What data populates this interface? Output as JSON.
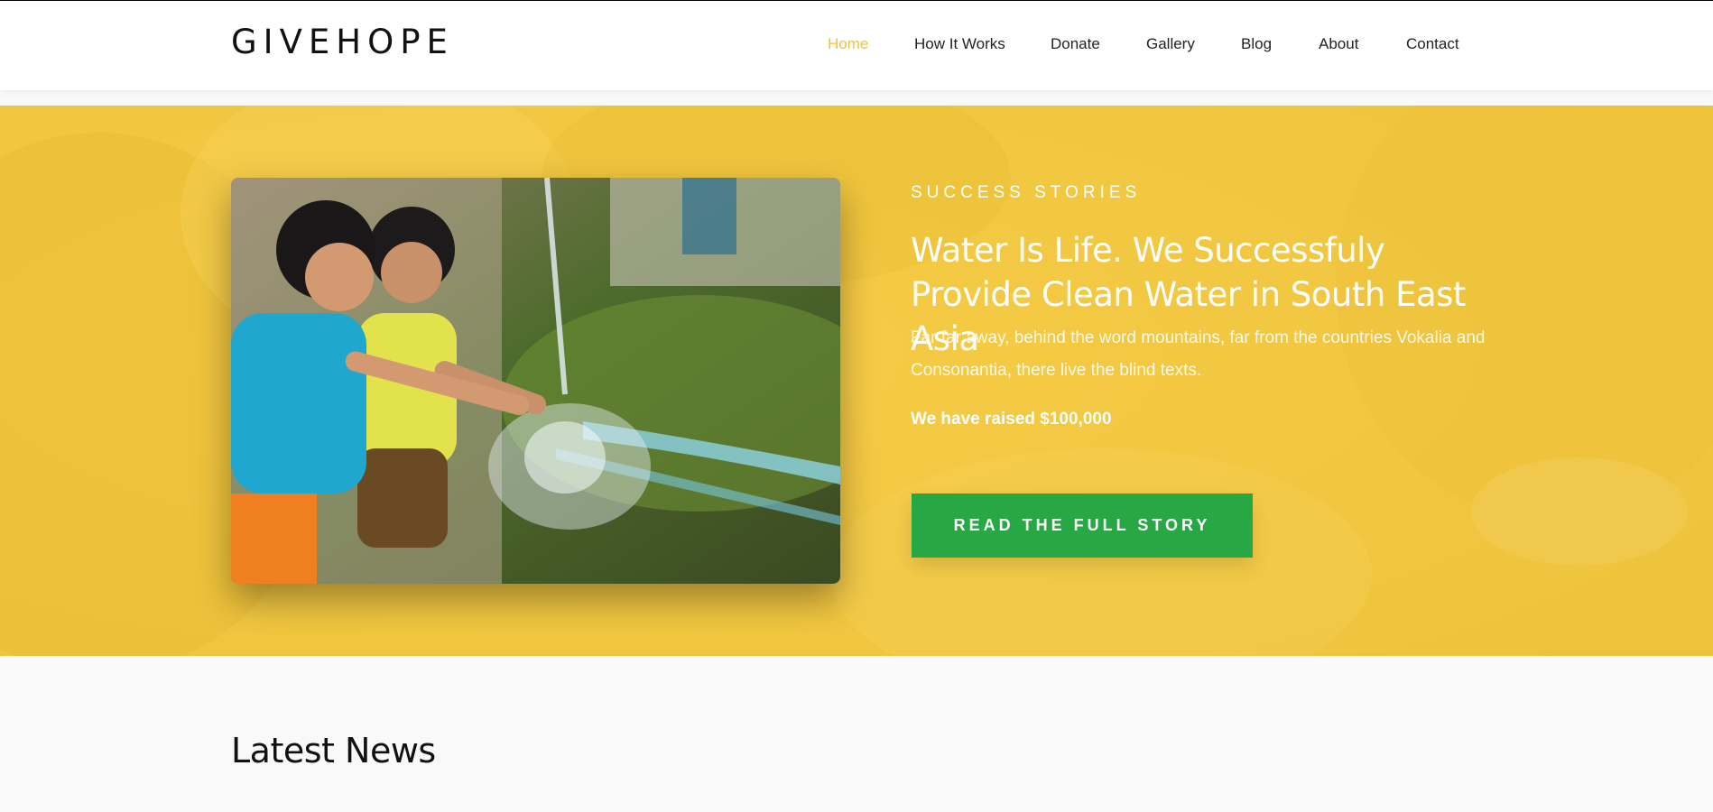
{
  "brand": {
    "logo_text": "GIVEHOPE"
  },
  "nav": {
    "items": [
      {
        "label": "Home",
        "active": true
      },
      {
        "label": "How It Works",
        "active": false
      },
      {
        "label": "Donate",
        "active": false
      },
      {
        "label": "Gallery",
        "active": false
      },
      {
        "label": "Blog",
        "active": false
      },
      {
        "label": "About",
        "active": false
      },
      {
        "label": "Contact",
        "active": false
      }
    ]
  },
  "hero": {
    "eyebrow": "SUCCESS STORIES",
    "headline": "Water Is Life. We Successfuly Provide Clean Water in South East Asia",
    "lede": "Far far away, behind the word mountains, far from the countries Vokalia and Consonantia, there live the blind texts.",
    "raised": "We have raised $100,000",
    "cta_label": "READ THE FULL STORY"
  },
  "news": {
    "title": "Latest News"
  },
  "colors": {
    "accent": "#f2c337",
    "hero_bg": "#f4c743",
    "cta": "#28a745",
    "text_dark": "#111111",
    "page_bg": "#f9f9f9"
  }
}
